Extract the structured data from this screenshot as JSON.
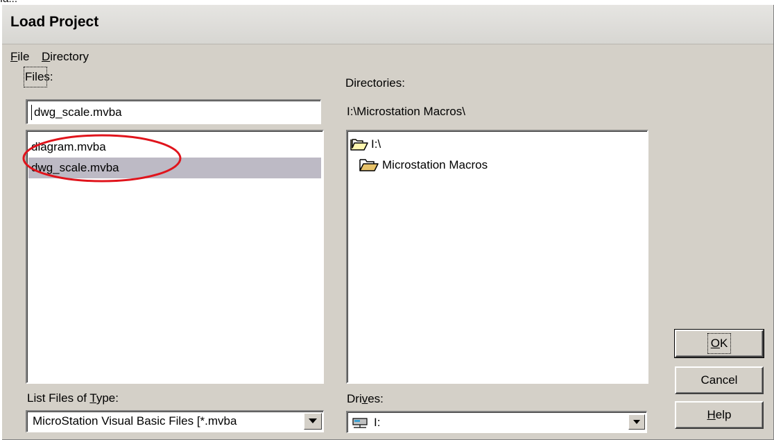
{
  "top_fragment_text": "fa...",
  "window": {
    "title": "Load Project"
  },
  "menu": [
    {
      "label": "File",
      "mnemonic": "F",
      "rest": "ile"
    },
    {
      "label": "Directory",
      "mnemonic": "D",
      "rest": "irectory"
    }
  ],
  "files": {
    "label": "Files:",
    "input_value": "dwg_scale.mvba",
    "items": [
      {
        "name": "diagram.mvba",
        "selected": false
      },
      {
        "name": "dwg_scale.mvba",
        "selected": true
      }
    ]
  },
  "directories": {
    "label": "Directories:",
    "current_path": "I:\\Microstation Macros\\",
    "items": [
      {
        "name": "I:\\",
        "icon": "open-folder-icon"
      },
      {
        "name": "Microstation Macros",
        "icon": "open-folder-icon"
      }
    ]
  },
  "file_type": {
    "label_prefix": "List Files of ",
    "label_mnemonic": "T",
    "label_suffix": "ype:",
    "selected": "MicroStation Visual Basic Files [*.mvba"
  },
  "drives": {
    "label_prefix": "Dri",
    "label_mnemonic": "v",
    "label_suffix": "es:",
    "selected": "I:"
  },
  "buttons": {
    "ok": {
      "mnemonic": "O",
      "rest": "K"
    },
    "cancel": {
      "label": "Cancel"
    },
    "help": {
      "mnemonic": "H",
      "rest": "elp"
    }
  },
  "colors": {
    "dialog_bg": "#d4d0c8",
    "selection_bg": "#bdbac5",
    "annotation": "#e0141c"
  }
}
